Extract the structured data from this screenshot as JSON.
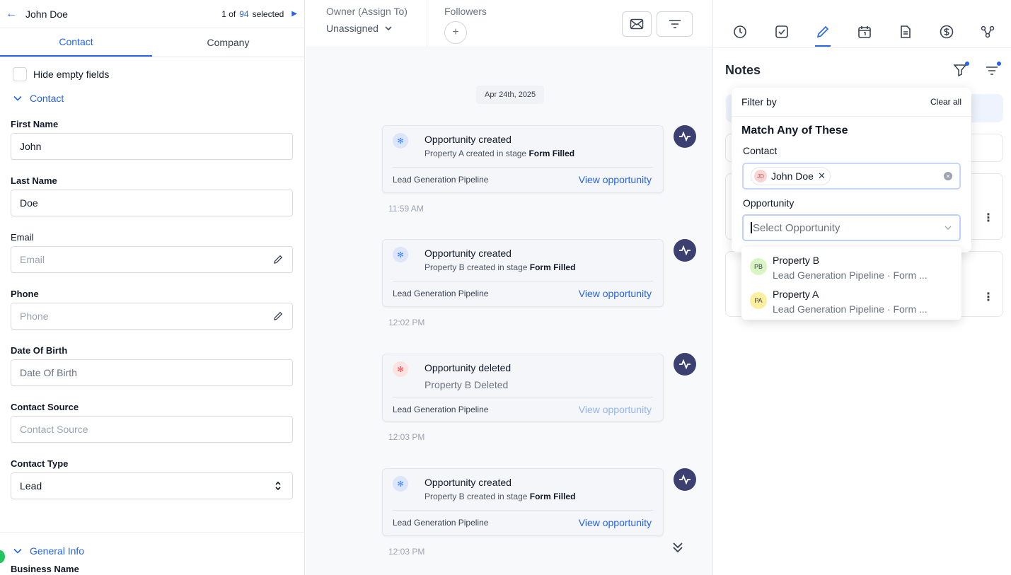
{
  "contact_header": {
    "name": "John Doe",
    "pager_prefix": "1 of",
    "pager_count": "94",
    "pager_suffix": "selected"
  },
  "left_tabs": [
    "Contact",
    "Company"
  ],
  "hide_empty_label": "Hide empty fields",
  "contact_section_label": "Contact",
  "fields": {
    "first_name": {
      "label": "First Name",
      "value": "John"
    },
    "last_name": {
      "label": "Last Name",
      "value": "Doe"
    },
    "email": {
      "label": "Email",
      "placeholder": "Email"
    },
    "phone": {
      "label": "Phone",
      "placeholder": "Phone"
    },
    "dob": {
      "label": "Date Of Birth",
      "placeholder": "Date Of Birth"
    },
    "source": {
      "label": "Contact Source",
      "placeholder": "Contact Source"
    },
    "type": {
      "label": "Contact Type",
      "value": "Lead"
    }
  },
  "general_info_label": "General Info",
  "partial_label": "Business Name",
  "owner": {
    "label": "Owner (Assign To)",
    "value": "Unassigned"
  },
  "followers_label": "Followers",
  "timeline_date": "Apr 24th, 2025",
  "events": [
    {
      "title": "Opportunity created",
      "sub_prefix": "Property A created in stage",
      "sub_stage": "Form Filled",
      "pipeline": "Lead Generation Pipeline",
      "link": "View opportunity",
      "time": "11:59 AM"
    },
    {
      "title": "Opportunity created",
      "sub_prefix": "Property B created in stage",
      "sub_stage": "Form Filled",
      "pipeline": "Lead Generation Pipeline",
      "link": "View opportunity",
      "time": "12:02 PM"
    },
    {
      "title": "Opportunity deleted",
      "sub_prefix": "Property B Deleted",
      "sub_stage": "",
      "pipeline": "Lead Generation Pipeline",
      "link": "View opportunity",
      "time": "12:03 PM"
    },
    {
      "title": "Opportunity created",
      "sub_prefix": "Property B created in stage",
      "sub_stage": "Form Filled",
      "pipeline": "Lead Generation Pipeline",
      "link": "View opportunity",
      "time": "12:03 PM"
    }
  ],
  "notes_title": "Notes",
  "filter": {
    "title": "Filter by",
    "clear": "Clear all",
    "match": "Match Any of These",
    "contact_label": "Contact",
    "contact_chip_initials": "JD",
    "contact_chip_name": "John Doe",
    "opportunity_label": "Opportunity",
    "opportunity_placeholder": "Select Opportunity"
  },
  "opportunity_options": [
    {
      "initials": "PB",
      "name": "Property B",
      "sub": "Lead Generation Pipeline · Form ..."
    },
    {
      "initials": "PA",
      "name": "Property A",
      "sub": "Lead Generation Pipeline · Form ..."
    }
  ],
  "colors": {
    "accent": "#2563eb",
    "activity_badge": "#3b4070",
    "pb_avatar": "#d9f5c4",
    "pa_avatar": "#fdefa0",
    "jd_avatar": "#fbd5d5"
  }
}
